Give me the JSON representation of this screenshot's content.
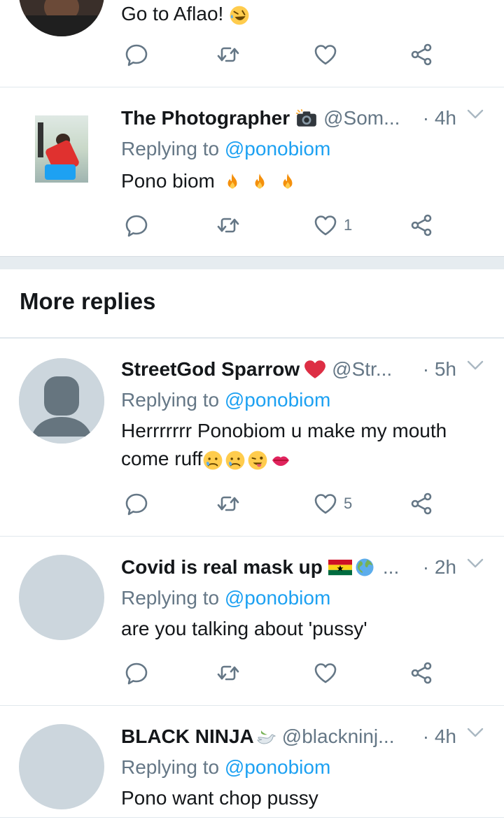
{
  "tweets": [
    {
      "name": "",
      "handle": "",
      "time": "",
      "replying_prefix": "",
      "mention": "",
      "text": "Go to Aflao!",
      "like_count": ""
    },
    {
      "name": "The Photographer",
      "handle": "@Som...",
      "time": "· 4h",
      "replying_prefix": "Replying to",
      "mention": "@ponobiom",
      "text": "Pono biom",
      "like_count": "1"
    },
    {
      "name": "StreetGod Sparrow",
      "handle": "@Str...",
      "time": "· 5h",
      "replying_prefix": "Replying to",
      "mention": "@ponobiom",
      "text": "Herrrrrrr Ponobiom u make my mouth come ruff",
      "like_count": "5"
    },
    {
      "name": "Covid is real mask up",
      "handle": "...",
      "time": "· 2h",
      "replying_prefix": "Replying to",
      "mention": "@ponobiom",
      "text": "are you talking about 'pussy'",
      "like_count": ""
    },
    {
      "name": "BLACK NINJA",
      "handle": "@blackninj...",
      "time": "· 4h",
      "replying_prefix": "Replying to",
      "mention": "@ponobiom",
      "text": "Pono want chop pussy",
      "like_count": ""
    }
  ],
  "section": {
    "title": "More replies"
  },
  "icons": [
    "reply-icon",
    "retweet-icon",
    "like-icon",
    "share-icon",
    "chevron-down-icon"
  ],
  "colors": {
    "link": "#1da1f2",
    "secondary": "#657786",
    "divider": "#e1e8ed",
    "heart_emoji": "#e0245e",
    "fire": "#f4900c"
  }
}
